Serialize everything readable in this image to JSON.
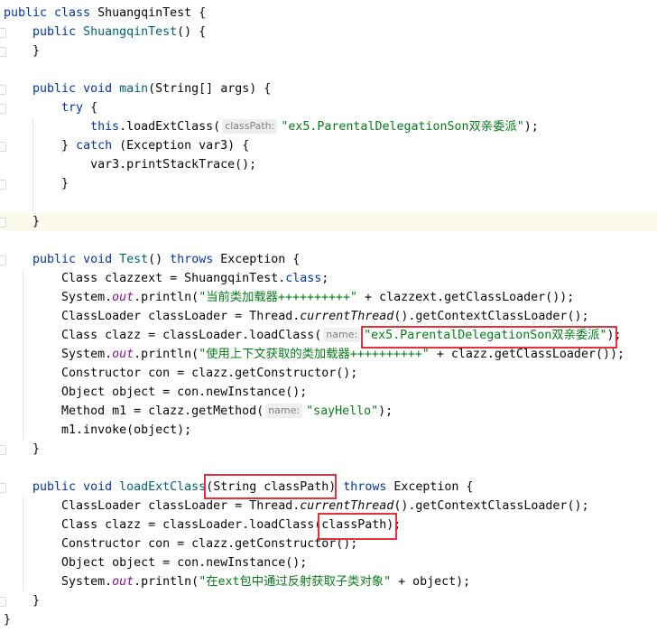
{
  "editor": {
    "accent_highlight_color": "#e8303a",
    "lines": [
      {
        "gutter": false,
        "tokens": [
          {
            "c": "k",
            "t": "public class "
          },
          {
            "c": "p",
            "t": "ShuangqinTest {"
          }
        ]
      },
      {
        "gutter": true,
        "tokens": [
          {
            "c": "p",
            "t": "    "
          },
          {
            "c": "k",
            "t": "public "
          },
          {
            "c": "m",
            "t": "ShuangqinTest"
          },
          {
            "c": "p",
            "t": "() {"
          }
        ]
      },
      {
        "gutter": true,
        "tokens": [
          {
            "c": "p",
            "t": "    }"
          }
        ]
      },
      {
        "gutter": false,
        "tokens": []
      },
      {
        "gutter": true,
        "tokens": [
          {
            "c": "p",
            "t": "    "
          },
          {
            "c": "k",
            "t": "public void "
          },
          {
            "c": "m",
            "t": "main"
          },
          {
            "c": "p",
            "t": "(String[] args) {"
          }
        ]
      },
      {
        "gutter": true,
        "tokens": [
          {
            "c": "p",
            "t": "        "
          },
          {
            "c": "k",
            "t": "try"
          },
          {
            "c": "p",
            "t": " {"
          }
        ]
      },
      {
        "gutter": false,
        "tokens": [
          {
            "c": "p",
            "t": "            "
          },
          {
            "c": "k",
            "t": "this"
          },
          {
            "c": "p",
            "t": ".loadExtClass("
          },
          {
            "c": "h",
            "t": "classPath:"
          },
          {
            "c": "s",
            "t": "\"ex5.ParentalDelegationSon双亲委派\""
          },
          {
            "c": "p",
            "t": ");"
          }
        ]
      },
      {
        "gutter": true,
        "tokens": [
          {
            "c": "p",
            "t": "        } "
          },
          {
            "c": "k",
            "t": "catch"
          },
          {
            "c": "p",
            "t": " (Exception var3) {"
          }
        ]
      },
      {
        "gutter": false,
        "tokens": [
          {
            "c": "p",
            "t": "            var3.printStackTrace();"
          }
        ]
      },
      {
        "gutter": true,
        "tokens": [
          {
            "c": "p",
            "t": "        }"
          }
        ]
      },
      {
        "gutter": false,
        "tokens": []
      },
      {
        "gutter": true,
        "hl": true,
        "tokens": [
          {
            "c": "p",
            "t": "    }"
          }
        ]
      },
      {
        "gutter": false,
        "tokens": []
      },
      {
        "gutter": true,
        "tokens": [
          {
            "c": "p",
            "t": "    "
          },
          {
            "c": "k",
            "t": "public void "
          },
          {
            "c": "m",
            "t": "Test"
          },
          {
            "c": "p",
            "t": "() "
          },
          {
            "c": "k",
            "t": "throws "
          },
          {
            "c": "p",
            "t": "Exception {"
          }
        ]
      },
      {
        "gutter": false,
        "tokens": [
          {
            "c": "p",
            "t": "        Class clazzext = ShuangqinTest."
          },
          {
            "c": "k",
            "t": "class"
          },
          {
            "c": "p",
            "t": ";"
          }
        ]
      },
      {
        "gutter": false,
        "tokens": [
          {
            "c": "p",
            "t": "        System."
          },
          {
            "c": "st",
            "t": "out"
          },
          {
            "c": "p",
            "t": ".println("
          },
          {
            "c": "s",
            "t": "\"当前类加载器++++++++++\""
          },
          {
            "c": "p",
            "t": " + clazzext.getClassLoader());"
          }
        ]
      },
      {
        "gutter": false,
        "tokens": [
          {
            "c": "p",
            "t": "        ClassLoader classLoader = Thread."
          },
          {
            "c": "i",
            "t": "currentThread"
          },
          {
            "c": "p",
            "t": "().getContextClassLoader();"
          }
        ]
      },
      {
        "gutter": false,
        "tokens": [
          {
            "c": "p",
            "t": "        Class clazz = classLoader.loadClass("
          },
          {
            "c": "h",
            "t": "name:"
          },
          {
            "c": "s",
            "t": "\"ex5.ParentalDelegationSon双亲委派\""
          },
          {
            "c": "p",
            "t": ");"
          }
        ]
      },
      {
        "gutter": false,
        "tokens": [
          {
            "c": "p",
            "t": "        System."
          },
          {
            "c": "st",
            "t": "out"
          },
          {
            "c": "p",
            "t": ".println("
          },
          {
            "c": "s",
            "t": "\"使用上下文获取的类加载器++++++++++\""
          },
          {
            "c": "p",
            "t": " + clazz.getClassLoader());"
          }
        ]
      },
      {
        "gutter": false,
        "tokens": [
          {
            "c": "p",
            "t": "        Constructor con = clazz.getConstructor();"
          }
        ]
      },
      {
        "gutter": false,
        "tokens": [
          {
            "c": "p",
            "t": "        Object object = con.newInstance();"
          }
        ]
      },
      {
        "gutter": false,
        "tokens": [
          {
            "c": "p",
            "t": "        Method m1 = clazz.getMethod("
          },
          {
            "c": "h",
            "t": "name:"
          },
          {
            "c": "s",
            "t": "\"sayHello\""
          },
          {
            "c": "p",
            "t": ");"
          }
        ]
      },
      {
        "gutter": false,
        "tokens": [
          {
            "c": "p",
            "t": "        m1.invoke(object);"
          }
        ]
      },
      {
        "gutter": true,
        "tokens": [
          {
            "c": "p",
            "t": "    }"
          }
        ]
      },
      {
        "gutter": false,
        "tokens": []
      },
      {
        "gutter": true,
        "tokens": [
          {
            "c": "p",
            "t": "    "
          },
          {
            "c": "k",
            "t": "public void "
          },
          {
            "c": "m",
            "t": "loadExtClass"
          },
          {
            "c": "p",
            "t": "(String classPath) "
          },
          {
            "c": "k",
            "t": "throws "
          },
          {
            "c": "p",
            "t": "Exception {"
          }
        ]
      },
      {
        "gutter": false,
        "tokens": [
          {
            "c": "p",
            "t": "        ClassLoader classLoader = Thread."
          },
          {
            "c": "i",
            "t": "currentThread"
          },
          {
            "c": "p",
            "t": "().getContextClassLoader();"
          }
        ]
      },
      {
        "gutter": false,
        "tokens": [
          {
            "c": "p",
            "t": "        Class clazz = classLoader.loadClass(classPath);"
          }
        ]
      },
      {
        "gutter": false,
        "tokens": [
          {
            "c": "p",
            "t": "        Constructor con = clazz.getConstructor();"
          }
        ]
      },
      {
        "gutter": false,
        "tokens": [
          {
            "c": "p",
            "t": "        Object object = con.newInstance();"
          }
        ]
      },
      {
        "gutter": false,
        "tokens": [
          {
            "c": "p",
            "t": "        System."
          },
          {
            "c": "st",
            "t": "out"
          },
          {
            "c": "p",
            "t": ".println("
          },
          {
            "c": "s",
            "t": "\"在ext包中通过反射获取子类对象\""
          },
          {
            "c": "p",
            "t": " + object);"
          }
        ]
      },
      {
        "gutter": true,
        "tokens": [
          {
            "c": "p",
            "t": "    }"
          }
        ]
      },
      {
        "gutter": false,
        "tokens": [
          {
            "c": "p",
            "t": "}"
          }
        ]
      }
    ]
  }
}
